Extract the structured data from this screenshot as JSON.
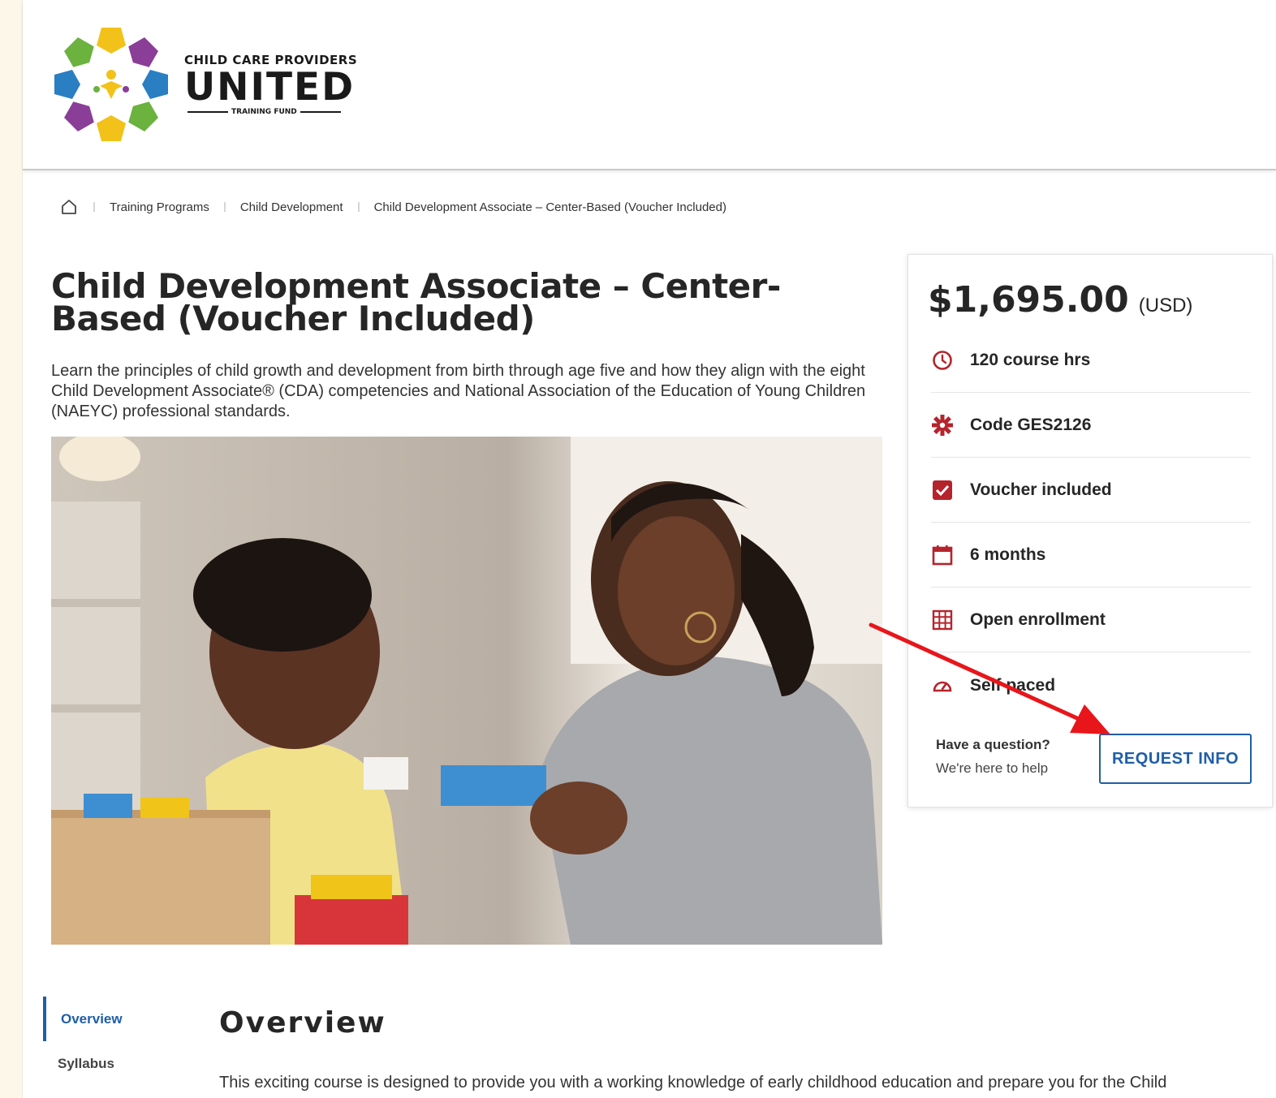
{
  "header": {
    "logo": {
      "top_text": "CHILD CARE PROVIDERS",
      "main_text": "UNITED",
      "sub_text": "TRAINING FUND"
    }
  },
  "breadcrumb": {
    "items": [
      {
        "label": "Training Programs"
      },
      {
        "label": "Child Development"
      },
      {
        "label": "Child Development Associate – Center-Based (Voucher Included)"
      }
    ]
  },
  "course": {
    "title": "Child Development Associate – Center-Based (Voucher Included)",
    "description": "Learn the principles of child growth and development from birth through age five and how they align with the eight Child Development Associate® (CDA) competencies and National Association of the Education of Young Children (NAEYC) professional standards."
  },
  "card": {
    "price": "$1,695.00",
    "currency": "(USD)",
    "features": [
      {
        "icon": "clock-icon",
        "label": "120 course hrs"
      },
      {
        "icon": "gear-icon",
        "label": "Code GES2126"
      },
      {
        "icon": "checkbox-icon",
        "label": "Voucher included"
      },
      {
        "icon": "calendar-icon",
        "label": "6 months"
      },
      {
        "icon": "grid-icon",
        "label": "Open enrollment"
      },
      {
        "icon": "speedometer-icon",
        "label": "Self paced"
      }
    ],
    "question": "Have a question?",
    "help": "We're here to help",
    "request_button": "REQUEST INFO"
  },
  "side_nav": {
    "items": [
      {
        "label": "Overview"
      },
      {
        "label": "Syllabus"
      }
    ]
  },
  "overview": {
    "title": "Overview",
    "text": "This exciting course is designed to provide you with a working knowledge of early childhood education and prepare you for the Child"
  },
  "colors": {
    "accent": "#1f5ea8",
    "icon": "#b5242b",
    "annotation_arrow": "#e8161b"
  }
}
